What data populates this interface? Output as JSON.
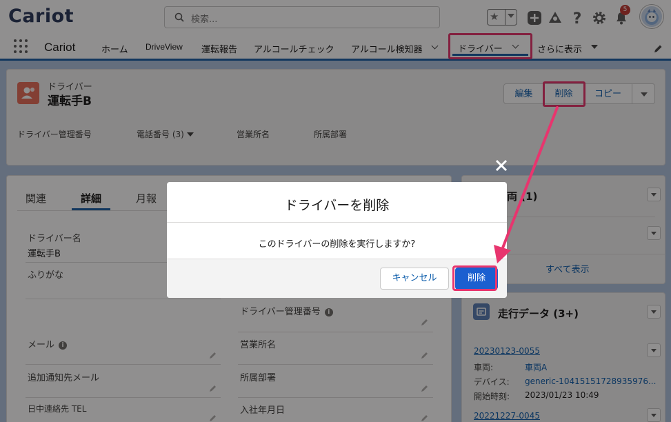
{
  "header": {
    "logo": "Cariot",
    "search_placeholder": "検索...",
    "notification_count": "5"
  },
  "nav": {
    "app_name": "Cariot",
    "items": [
      {
        "label": "ホーム"
      },
      {
        "label": "DriveView"
      },
      {
        "label": "運転報告"
      },
      {
        "label": "アルコールチェック"
      },
      {
        "label": "アルコール検知器"
      }
    ],
    "active_tab": "ドライバー",
    "more": "さらに表示"
  },
  "record": {
    "type": "ドライバー",
    "name": "運転手B",
    "buttons": {
      "edit": "編集",
      "delete": "削除",
      "copy": "コピー"
    },
    "fields": {
      "driver_no": "ドライバー管理番号",
      "phone": "電話番号 (3)",
      "office": "営業所名",
      "dept": "所属部署"
    }
  },
  "tabs": {
    "related": "関連",
    "detail": "詳細",
    "monthly": "月報"
  },
  "detail": {
    "driver_name_label": "ドライバー名",
    "driver_name_value": "運転手B",
    "furigana_label": "ふりがな",
    "driver_no_label": "ドライバー管理番号",
    "email_label": "メール",
    "office_label": "営業所名",
    "extra_email_label": "追加通知先メール",
    "dept_label": "所属部署",
    "day_tel_label": "日中連絡先 TEL",
    "hire_date_label": "入社年月日"
  },
  "right": {
    "vehicle_title": "車両 (1)",
    "show_all": "すべて表示",
    "trip_title": "走行データ (3+)",
    "trips": [
      {
        "id": "20230123-0055",
        "vehicle_label": "車両:",
        "vehicle": "車両A",
        "device_label": "デバイス:",
        "device": "generic-10415151728935976...",
        "start_label": "開始時刻:",
        "start": "2023/01/23 10:49"
      },
      {
        "id": "20221227-0045"
      }
    ]
  },
  "modal": {
    "title": "ドライバーを削除",
    "message": "このドライバーの削除を実行しますか?",
    "cancel": "キャンセル",
    "confirm": "削除"
  },
  "colors": {
    "brand": "#1b5fa7",
    "highlight": "#e8356e",
    "confirm": "#1b5fd0",
    "record_icon": "#e86e5a"
  }
}
